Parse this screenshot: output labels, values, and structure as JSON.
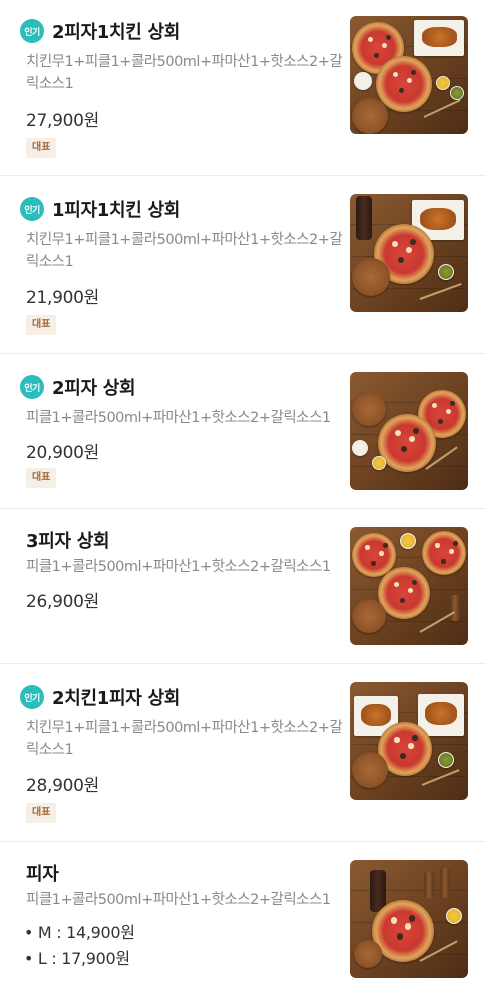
{
  "menu": {
    "items": [
      {
        "badge": "인기",
        "title": "2피자1치킨 상회",
        "description": "치킨무1+피클1+콜라500ml+파마산1+핫소스2+갈릭소스1",
        "price": "27,900원",
        "tag": "대표"
      },
      {
        "badge": "인기",
        "title": "1피자1치킨 상회",
        "description": "치킨무1+피클1+콜라500ml+파마산1+핫소스2+갈릭소스1",
        "price": "21,900원",
        "tag": "대표"
      },
      {
        "badge": "인기",
        "title": "2피자 상회",
        "description": "피클1+콜라500ml+파마산1+핫소스2+갈릭소스1",
        "price": "20,900원",
        "tag": "대표"
      },
      {
        "title": "3피자 상회",
        "description": "피클1+콜라500ml+파마산1+핫소스2+갈릭소스1",
        "price": "26,900원"
      },
      {
        "badge": "인기",
        "title": "2치킨1피자 상회",
        "description": "치킨무1+피클1+콜라500ml+파마산1+핫소스2+갈릭소스1",
        "price": "28,900원",
        "tag": "대표"
      },
      {
        "title": "피자",
        "description": "피클1+콜라500ml+파마산1+핫소스2+갈릭소스1",
        "size_prices": [
          "• M : 14,900원",
          "• L : 17,900원"
        ]
      }
    ]
  }
}
